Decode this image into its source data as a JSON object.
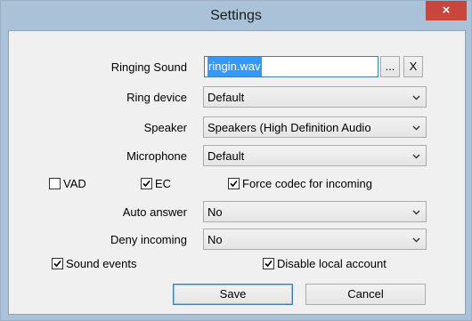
{
  "window": {
    "title": "Settings",
    "close_label": "×"
  },
  "form": {
    "ringing_sound": {
      "label": "Ringing Sound",
      "value": "ringin.wav",
      "browse_label": "...",
      "clear_label": "X"
    },
    "ring_device": {
      "label": "Ring device",
      "value": "Default"
    },
    "speaker": {
      "label": "Speaker",
      "value": "Speakers (High Definition Audio"
    },
    "microphone": {
      "label": "Microphone",
      "value": "Default"
    },
    "vad": {
      "label": "VAD",
      "checked": false
    },
    "ec": {
      "label": "EC",
      "checked": true
    },
    "force_codec": {
      "label": "Force codec for incoming",
      "checked": true
    },
    "auto_answer": {
      "label": "Auto answer",
      "value": "No"
    },
    "deny_incoming": {
      "label": "Deny incoming",
      "value": "No"
    },
    "sound_events": {
      "label": "Sound events",
      "checked": true
    },
    "disable_local_account": {
      "label": "Disable local account",
      "checked": true
    }
  },
  "buttons": {
    "save": "Save",
    "cancel": "Cancel"
  }
}
